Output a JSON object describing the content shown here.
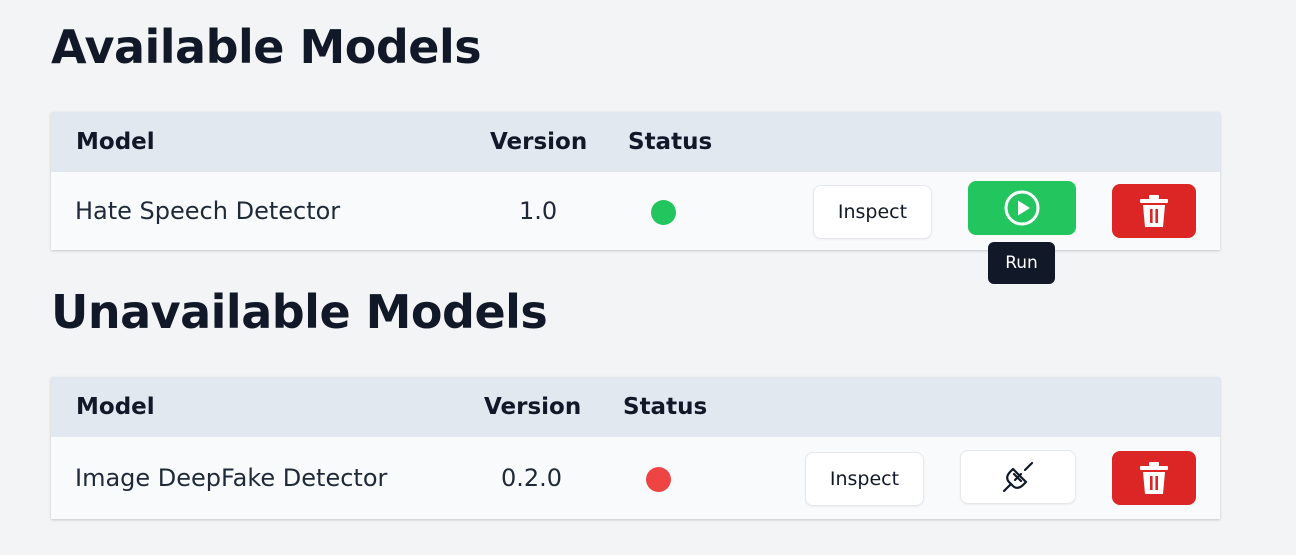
{
  "available": {
    "title": "Available Models",
    "columns": {
      "model": "Model",
      "version": "Version",
      "status": "Status"
    },
    "rows": [
      {
        "model": "Hate Speech Detector",
        "version": "1.0",
        "status": "available",
        "status_color": "#22c55e",
        "inspect_label": "Inspect",
        "run_tooltip": "Run"
      }
    ]
  },
  "unavailable": {
    "title": "Unavailable Models",
    "columns": {
      "model": "Model",
      "version": "Version",
      "status": "Status"
    },
    "rows": [
      {
        "model": "Image DeepFake Detector",
        "version": "0.2.0",
        "status": "unavailable",
        "status_color": "#ef4444",
        "inspect_label": "Inspect"
      }
    ]
  },
  "icons": {
    "run": "play-circle-icon",
    "delete": "trash-icon",
    "connect": "plug-icon"
  },
  "colors": {
    "run_button": "#22c55e",
    "delete_button": "#dc2626",
    "tooltip_bg": "#111827"
  }
}
